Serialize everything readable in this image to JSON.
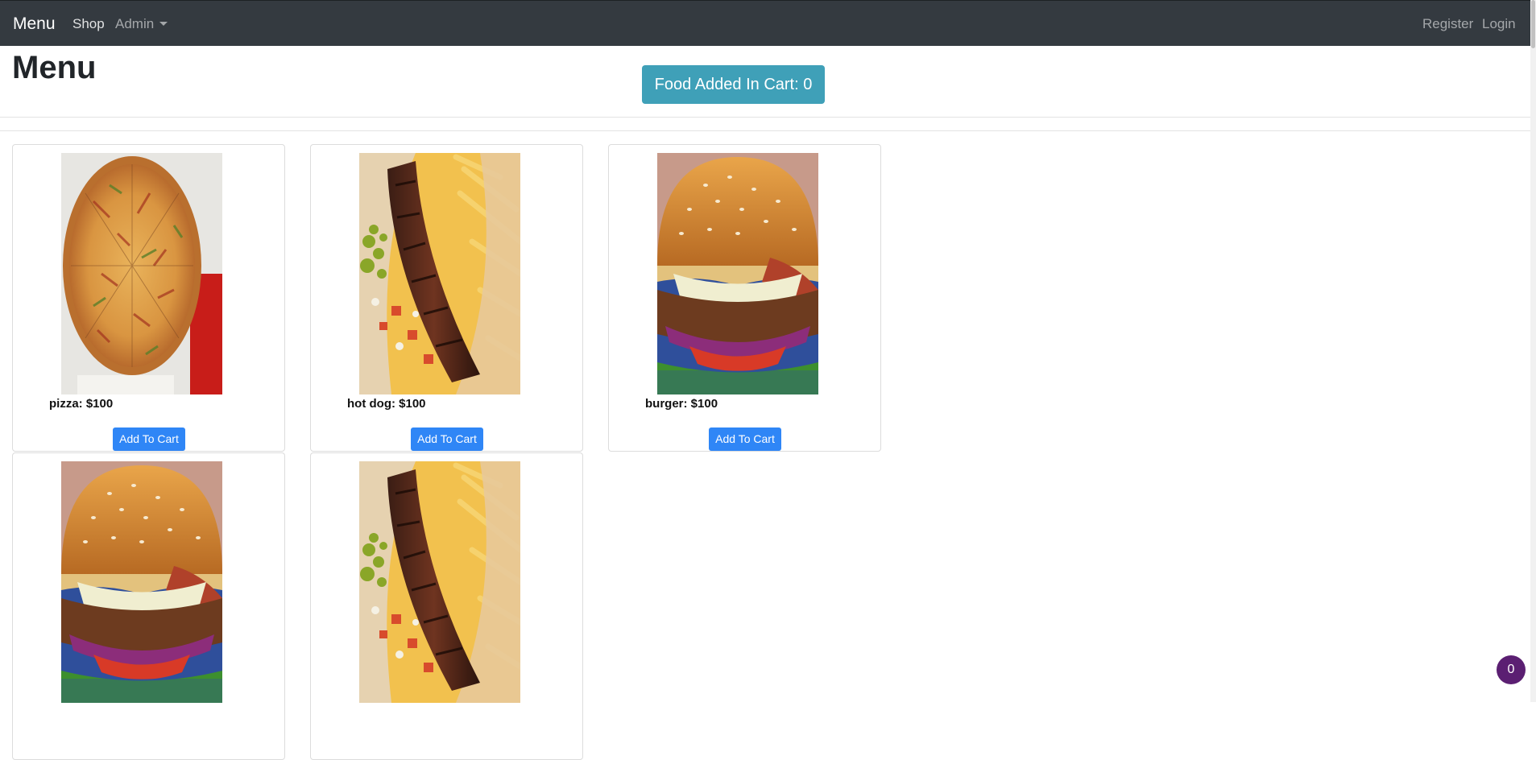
{
  "navbar": {
    "brand": "Menu",
    "links": {
      "shop": "Shop",
      "admin": "Admin",
      "register": "Register",
      "login": "Login"
    }
  },
  "header": {
    "title": "Menu",
    "cart_counter": "Food Added In Cart: 0"
  },
  "menu": {
    "items": [
      {
        "label": "pizza: $100",
        "image": "pizza-photo",
        "button": "Add To Cart"
      },
      {
        "label": "hot dog: $100",
        "image": "hotdog-photo",
        "button": "Add To Cart"
      },
      {
        "label": "burger: $100",
        "image": "burger-photo",
        "button": "Add To Cart"
      },
      {
        "image": "burger-photo"
      },
      {
        "image": "hotdog-photo"
      }
    ]
  },
  "badge": {
    "count": "0"
  },
  "colors": {
    "navbar": "#343a40",
    "cart_counter": "#3fa0b8",
    "button": "#2f86f6",
    "badge": "#5b1f72"
  }
}
